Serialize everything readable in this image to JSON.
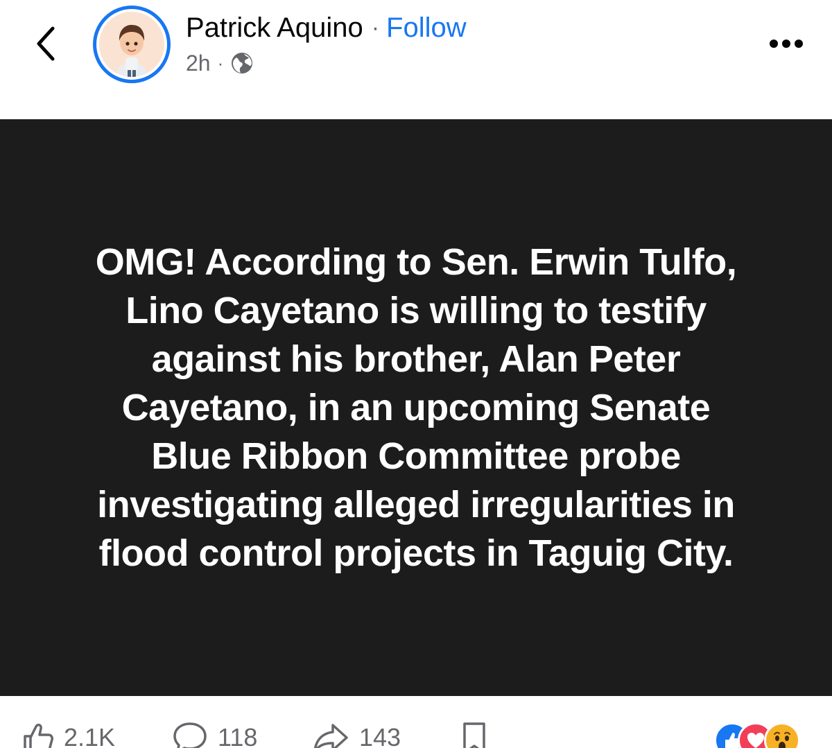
{
  "header": {
    "author_name": "Patrick Aquino",
    "separator": "·",
    "follow_label": "Follow",
    "time_ago": "2h",
    "meta_separator": "·",
    "audience_icon": "globe-icon",
    "back_icon": "chevron-left-icon",
    "more_icon": "more-horizontal-icon"
  },
  "post": {
    "background_color": "#1c1c1c",
    "text_color": "#ffffff",
    "text": "OMG! According to Sen. Erwin Tulfo, Lino Cayetano is willing to testify against his brother, Alan Peter Cayetano, in an upcoming Senate Blue Ribbon Committee probe investigating alleged irregularities in flood control projects in Taguig City."
  },
  "actions": {
    "like_count": "2.1K",
    "comment_count": "118",
    "share_count": "143",
    "like_icon": "thumbs-up-icon",
    "comment_icon": "comment-bubble-icon",
    "share_icon": "share-arrow-icon",
    "save_icon": "bookmark-icon"
  },
  "reactions": [
    "like",
    "love",
    "wow"
  ],
  "colors": {
    "accent": "#1877f2",
    "secondary_text": "#65676b",
    "love": "#f33e58",
    "wow": "#f7b125"
  }
}
